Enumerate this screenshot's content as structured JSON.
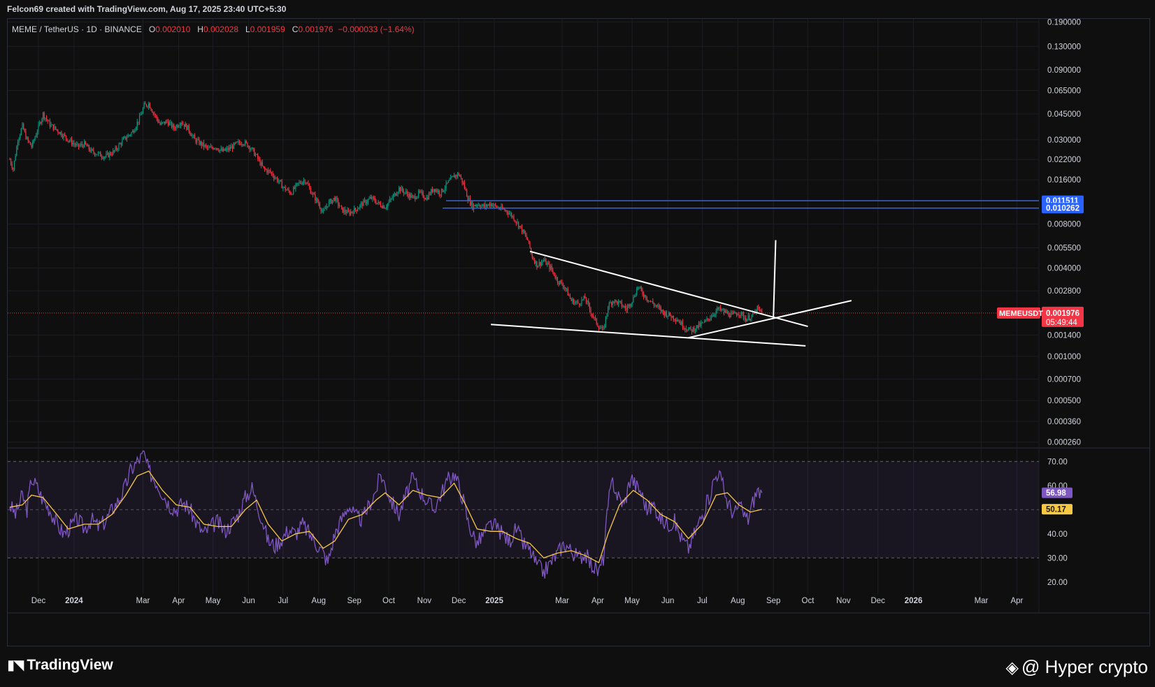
{
  "header": {
    "text": "Felcon69 created with TradingView.com, Aug 17, 2025 23:40 UTC+5:30"
  },
  "legend": {
    "symbol": "MEME / TetherUS · 1D · BINANCE",
    "o_label": "O",
    "o_value": "0.002010",
    "h_label": "H",
    "h_value": "0.002028",
    "l_label": "L",
    "l_value": "0.001959",
    "c_label": "C",
    "c_value": "0.001976",
    "change": "−0.000033 (−1.64%)"
  },
  "footer": {
    "brand": "TradingView",
    "watermark": "@ Hyper  crypto"
  },
  "colors": {
    "background": "#0f0f0f",
    "down": "#f23645",
    "up": "#089981",
    "level": "#2962ff",
    "rsi": "#7e57c2",
    "rsi_ma": "#f7c843",
    "annotation": "#ffffff"
  },
  "chart_data": [
    {
      "type": "line",
      "name": "price",
      "scale": "log",
      "y_ticks": [
        "0.190000",
        "0.130000",
        "0.090000",
        "0.065000",
        "0.045000",
        "0.030000",
        "0.022000",
        "0.016000",
        "0.008000",
        "0.005500",
        "0.004000",
        "0.002800",
        "0.001400",
        "0.001000",
        "0.000700",
        "0.000500",
        "0.000360",
        "0.000260"
      ],
      "y_tick_values": [
        0.19,
        0.13,
        0.09,
        0.065,
        0.045,
        0.03,
        0.022,
        0.016,
        0.008,
        0.0055,
        0.004,
        0.0028,
        0.0014,
        0.001,
        0.0007,
        0.0005,
        0.00036,
        0.00026
      ],
      "ylim": [
        0.00024,
        0.2
      ],
      "x_ticks": [
        {
          "label": "Dec",
          "d": 0
        },
        {
          "label": "2024",
          "d": 31
        },
        {
          "label": "Mar",
          "d": 91
        },
        {
          "label": "Apr",
          "d": 122
        },
        {
          "label": "May",
          "d": 152
        },
        {
          "label": "Jun",
          "d": 183
        },
        {
          "label": "Jul",
          "d": 213
        },
        {
          "label": "Aug",
          "d": 244
        },
        {
          "label": "Sep",
          "d": 275
        },
        {
          "label": "Oct",
          "d": 305
        },
        {
          "label": "Nov",
          "d": 336
        },
        {
          "label": "Dec",
          "d": 366
        },
        {
          "label": "2025",
          "d": 397
        },
        {
          "label": "Mar",
          "d": 456
        },
        {
          "label": "Apr",
          "d": 487
        },
        {
          "label": "May",
          "d": 517
        },
        {
          "label": "Jun",
          "d": 548
        },
        {
          "label": "Jul",
          "d": 578
        },
        {
          "label": "Aug",
          "d": 609
        },
        {
          "label": "Sep",
          "d": 640
        },
        {
          "label": "Oct",
          "d": 670
        },
        {
          "label": "Nov",
          "d": 701
        },
        {
          "label": "Dec",
          "d": 731
        },
        {
          "label": "2026",
          "d": 762
        },
        {
          "label": "Mar",
          "d": 821
        },
        {
          "label": "Apr",
          "d": 852
        }
      ],
      "price_path": [
        [
          -25,
          0.022
        ],
        [
          -22,
          0.019
        ],
        [
          -18,
          0.03
        ],
        [
          -14,
          0.037
        ],
        [
          -10,
          0.03
        ],
        [
          -6,
          0.027
        ],
        [
          -2,
          0.033
        ],
        [
          4,
          0.045
        ],
        [
          10,
          0.038
        ],
        [
          18,
          0.034
        ],
        [
          26,
          0.03
        ],
        [
          34,
          0.027
        ],
        [
          40,
          0.028
        ],
        [
          46,
          0.025
        ],
        [
          52,
          0.024
        ],
        [
          58,
          0.023
        ],
        [
          66,
          0.025
        ],
        [
          74,
          0.03
        ],
        [
          82,
          0.034
        ],
        [
          88,
          0.042
        ],
        [
          92,
          0.051
        ],
        [
          96,
          0.053
        ],
        [
          100,
          0.046
        ],
        [
          106,
          0.038
        ],
        [
          112,
          0.04
        ],
        [
          118,
          0.036
        ],
        [
          124,
          0.04
        ],
        [
          130,
          0.036
        ],
        [
          136,
          0.03
        ],
        [
          142,
          0.028
        ],
        [
          148,
          0.026
        ],
        [
          154,
          0.027
        ],
        [
          160,
          0.025
        ],
        [
          166,
          0.026
        ],
        [
          172,
          0.028
        ],
        [
          178,
          0.029
        ],
        [
          184,
          0.027
        ],
        [
          190,
          0.023
        ],
        [
          196,
          0.019
        ],
        [
          202,
          0.018
        ],
        [
          208,
          0.016
        ],
        [
          214,
          0.014
        ],
        [
          220,
          0.013
        ],
        [
          226,
          0.015
        ],
        [
          232,
          0.016
        ],
        [
          238,
          0.013
        ],
        [
          244,
          0.011
        ],
        [
          248,
          0.0095
        ],
        [
          252,
          0.011
        ],
        [
          258,
          0.012
        ],
        [
          264,
          0.01
        ],
        [
          270,
          0.0095
        ],
        [
          276,
          0.01
        ],
        [
          282,
          0.011
        ],
        [
          290,
          0.012
        ],
        [
          296,
          0.011
        ],
        [
          302,
          0.0105
        ],
        [
          308,
          0.012
        ],
        [
          314,
          0.014
        ],
        [
          320,
          0.013
        ],
        [
          326,
          0.012
        ],
        [
          332,
          0.013
        ],
        [
          338,
          0.012
        ],
        [
          344,
          0.014
        ],
        [
          350,
          0.013
        ],
        [
          356,
          0.015
        ],
        [
          362,
          0.017
        ],
        [
          366,
          0.0175
        ],
        [
          370,
          0.015
        ],
        [
          374,
          0.012
        ],
        [
          378,
          0.0105
        ],
        [
          382,
          0.011
        ],
        [
          388,
          0.0105
        ],
        [
          394,
          0.011
        ],
        [
          398,
          0.0105
        ],
        [
          402,
          0.0102
        ],
        [
          408,
          0.0098
        ],
        [
          414,
          0.0088
        ],
        [
          420,
          0.0075
        ],
        [
          426,
          0.0062
        ],
        [
          430,
          0.0048
        ],
        [
          434,
          0.0042
        ],
        [
          440,
          0.0045
        ],
        [
          446,
          0.004
        ],
        [
          452,
          0.0033
        ],
        [
          458,
          0.003
        ],
        [
          464,
          0.0024
        ],
        [
          470,
          0.0023
        ],
        [
          476,
          0.0025
        ],
        [
          480,
          0.0021
        ],
        [
          484,
          0.0018
        ],
        [
          488,
          0.0016
        ],
        [
          492,
          0.0015
        ],
        [
          496,
          0.0022
        ],
        [
          500,
          0.0024
        ],
        [
          506,
          0.0023
        ],
        [
          512,
          0.0021
        ],
        [
          518,
          0.0025
        ],
        [
          522,
          0.003
        ],
        [
          526,
          0.0027
        ],
        [
          532,
          0.0024
        ],
        [
          538,
          0.0022
        ],
        [
          544,
          0.002
        ],
        [
          550,
          0.0019
        ],
        [
          556,
          0.0018
        ],
        [
          562,
          0.0016
        ],
        [
          568,
          0.0015
        ],
        [
          574,
          0.0016
        ],
        [
          580,
          0.0017
        ],
        [
          586,
          0.0019
        ],
        [
          592,
          0.0021
        ],
        [
          598,
          0.002
        ],
        [
          604,
          0.0019
        ],
        [
          610,
          0.002
        ],
        [
          616,
          0.0018
        ],
        [
          622,
          0.0019
        ],
        [
          626,
          0.0021
        ],
        [
          630,
          0.001976
        ]
      ],
      "levels": [
        {
          "label": "0.011511",
          "value": 0.011511,
          "from_d": 355
        },
        {
          "label": "0.010262",
          "value": 0.010262,
          "from_d": 352
        }
      ],
      "last_price": {
        "symbol": "MEMEUSDT",
        "value_label": "0.001976",
        "value": 0.001976,
        "countdown": "05:49:44"
      },
      "annotations": [
        {
          "type": "trendline",
          "from": [
            428,
            0.0052
          ],
          "to": [
            670,
            0.0016
          ]
        },
        {
          "type": "trendline",
          "from": [
            394,
            0.00165
          ],
          "to": [
            668,
            0.00118
          ]
        },
        {
          "type": "trendline",
          "from": [
            566,
            0.00134
          ],
          "to": [
            708,
            0.0024
          ]
        },
        {
          "type": "trendline",
          "from": [
            640,
            0.00185
          ],
          "to": [
            642,
            0.0062
          ]
        }
      ]
    },
    {
      "type": "line",
      "name": "RSI",
      "ylim": [
        15,
        75
      ],
      "y_ticks": [
        "70.00",
        "60.00",
        "40.00",
        "30.00",
        "20.00"
      ],
      "y_tick_values": [
        70,
        60,
        40,
        30,
        20
      ],
      "bands": [
        70,
        50,
        30
      ],
      "rsi_label": "56.98",
      "rsi_value": 56.98,
      "ma_label": "50.17",
      "ma_value": 50.17,
      "rsi_path": [
        [
          -25,
          52
        ],
        [
          -20,
          48
        ],
        [
          -14,
          56
        ],
        [
          -10,
          50
        ],
        [
          -6,
          63
        ],
        [
          -2,
          60
        ],
        [
          4,
          54
        ],
        [
          10,
          50
        ],
        [
          16,
          44
        ],
        [
          22,
          40
        ],
        [
          28,
          43
        ],
        [
          34,
          46
        ],
        [
          40,
          42
        ],
        [
          46,
          46
        ],
        [
          52,
          43
        ],
        [
          58,
          45
        ],
        [
          64,
          50
        ],
        [
          70,
          54
        ],
        [
          76,
          60
        ],
        [
          80,
          66
        ],
        [
          86,
          70
        ],
        [
          92,
          73
        ],
        [
          96,
          66
        ],
        [
          102,
          62
        ],
        [
          108,
          57
        ],
        [
          114,
          52
        ],
        [
          120,
          50
        ],
        [
          126,
          53
        ],
        [
          132,
          50
        ],
        [
          138,
          44
        ],
        [
          144,
          40
        ],
        [
          150,
          43
        ],
        [
          156,
          45
        ],
        [
          162,
          41
        ],
        [
          168,
          44
        ],
        [
          174,
          48
        ],
        [
          180,
          55
        ],
        [
          186,
          59
        ],
        [
          190,
          53
        ],
        [
          196,
          44
        ],
        [
          200,
          37
        ],
        [
          206,
          35
        ],
        [
          212,
          38
        ],
        [
          218,
          42
        ],
        [
          224,
          40
        ],
        [
          230,
          44
        ],
        [
          236,
          40
        ],
        [
          242,
          36
        ],
        [
          248,
          32
        ],
        [
          252,
          28
        ],
        [
          258,
          40
        ],
        [
          264,
          46
        ],
        [
          270,
          52
        ],
        [
          276,
          47
        ],
        [
          282,
          46
        ],
        [
          288,
          52
        ],
        [
          294,
          58
        ],
        [
          298,
          65
        ],
        [
          302,
          60
        ],
        [
          308,
          53
        ],
        [
          314,
          48
        ],
        [
          320,
          56
        ],
        [
          326,
          63
        ],
        [
          332,
          58
        ],
        [
          338,
          54
        ],
        [
          344,
          50
        ],
        [
          350,
          56
        ],
        [
          356,
          62
        ],
        [
          362,
          65
        ],
        [
          366,
          60
        ],
        [
          370,
          54
        ],
        [
          374,
          45
        ],
        [
          378,
          40
        ],
        [
          382,
          36
        ],
        [
          388,
          40
        ],
        [
          394,
          44
        ],
        [
          398,
          43
        ],
        [
          404,
          40
        ],
        [
          410,
          37
        ],
        [
          416,
          42
        ],
        [
          422,
          36
        ],
        [
          428,
          33
        ],
        [
          434,
          27
        ],
        [
          440,
          24
        ],
        [
          446,
          28
        ],
        [
          452,
          32
        ],
        [
          458,
          36
        ],
        [
          464,
          33
        ],
        [
          470,
          30
        ],
        [
          476,
          32
        ],
        [
          480,
          28
        ],
        [
          484,
          26
        ],
        [
          488,
          24
        ],
        [
          492,
          30
        ],
        [
          496,
          52
        ],
        [
          500,
          62
        ],
        [
          504,
          56
        ],
        [
          510,
          52
        ],
        [
          516,
          64
        ],
        [
          520,
          60
        ],
        [
          524,
          58
        ],
        [
          530,
          50
        ],
        [
          536,
          52
        ],
        [
          542,
          46
        ],
        [
          548,
          44
        ],
        [
          554,
          45
        ],
        [
          560,
          38
        ],
        [
          566,
          34
        ],
        [
          572,
          41
        ],
        [
          578,
          48
        ],
        [
          584,
          55
        ],
        [
          588,
          62
        ],
        [
          592,
          66
        ],
        [
          596,
          60
        ],
        [
          600,
          53
        ],
        [
          606,
          48
        ],
        [
          610,
          52
        ],
        [
          614,
          48
        ],
        [
          618,
          46
        ],
        [
          622,
          53
        ],
        [
          626,
          58
        ],
        [
          630,
          56.98
        ]
      ],
      "ma_path": [
        [
          -25,
          51
        ],
        [
          -14,
          52
        ],
        [
          -6,
          56
        ],
        [
          4,
          55
        ],
        [
          16,
          48
        ],
        [
          26,
          42
        ],
        [
          40,
          44
        ],
        [
          52,
          44
        ],
        [
          64,
          48
        ],
        [
          76,
          56
        ],
        [
          86,
          64
        ],
        [
          96,
          66
        ],
        [
          108,
          58
        ],
        [
          120,
          52
        ],
        [
          132,
          51
        ],
        [
          144,
          44
        ],
        [
          156,
          43
        ],
        [
          168,
          43
        ],
        [
          180,
          50
        ],
        [
          190,
          54
        ],
        [
          200,
          44
        ],
        [
          212,
          37
        ],
        [
          224,
          40
        ],
        [
          236,
          41
        ],
        [
          248,
          34
        ],
        [
          258,
          37
        ],
        [
          270,
          46
        ],
        [
          282,
          48
        ],
        [
          294,
          54
        ],
        [
          302,
          57
        ],
        [
          314,
          52
        ],
        [
          326,
          58
        ],
        [
          338,
          56
        ],
        [
          350,
          55
        ],
        [
          362,
          61
        ],
        [
          372,
          52
        ],
        [
          382,
          42
        ],
        [
          394,
          41
        ],
        [
          404,
          41
        ],
        [
          416,
          38
        ],
        [
          428,
          36
        ],
        [
          440,
          30
        ],
        [
          452,
          32
        ],
        [
          464,
          33
        ],
        [
          476,
          31
        ],
        [
          488,
          28
        ],
        [
          496,
          40
        ],
        [
          506,
          52
        ],
        [
          518,
          58
        ],
        [
          530,
          54
        ],
        [
          542,
          48
        ],
        [
          554,
          45
        ],
        [
          566,
          38
        ],
        [
          578,
          44
        ],
        [
          590,
          56
        ],
        [
          600,
          57
        ],
        [
          610,
          52
        ],
        [
          620,
          49
        ],
        [
          630,
          50.17
        ]
      ]
    }
  ]
}
